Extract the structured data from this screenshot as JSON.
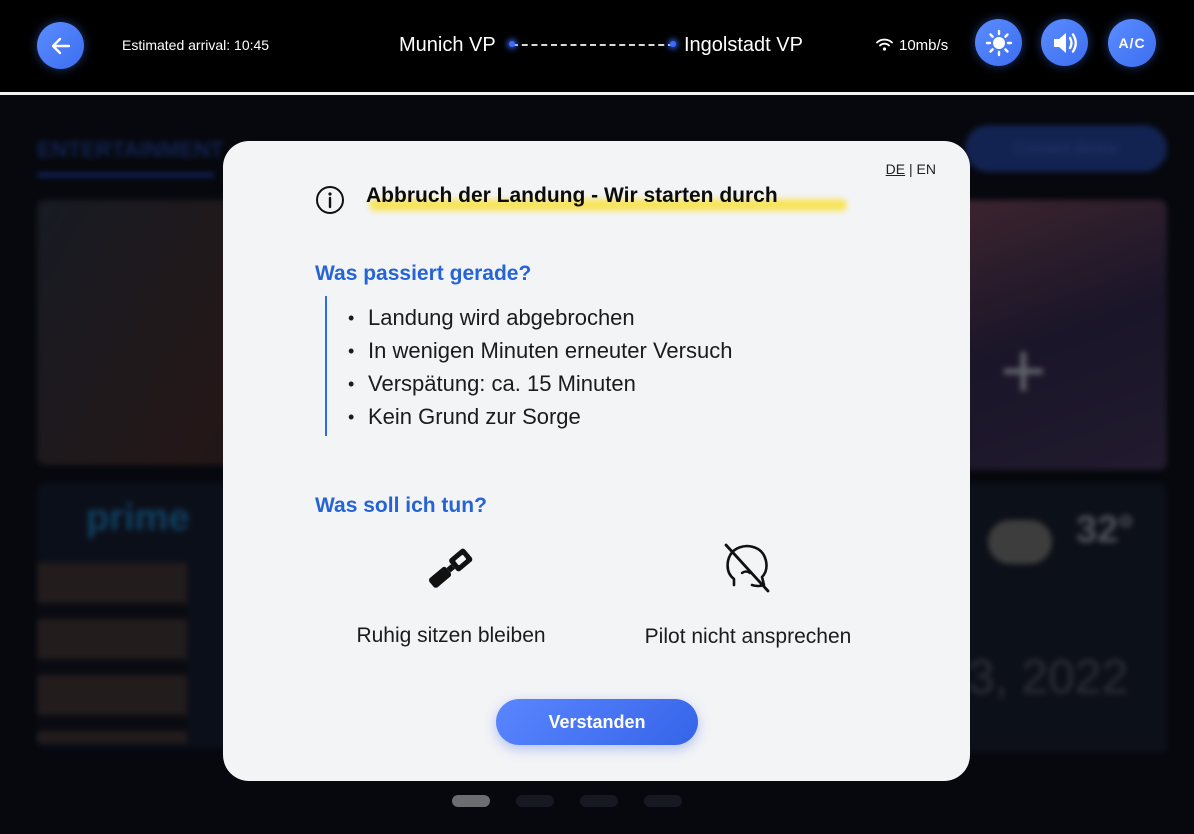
{
  "topbar": {
    "estimated_arrival": "Estimated arrival: 10:45",
    "route_from": "Munich VP",
    "route_to": "Ingolstadt VP",
    "connection_speed": "10mb/s",
    "ac_label": "A/C",
    "icons": [
      "back-arrow-icon",
      "wifi-icon",
      "brightness-icon",
      "volume-icon"
    ]
  },
  "background": {
    "tab_label": "ENTERTAINMENT",
    "connect_label": "Connect device",
    "streaming_logo": "prime",
    "plus_symbol": "+",
    "weather_temp": "32°",
    "date_fragment": "3, 2022"
  },
  "modal": {
    "lang_de": "DE",
    "lang_sep": "|",
    "lang_en": "EN",
    "title": "Abbruch der Landung  - Wir starten durch",
    "section_what_happens": "Was passiert gerade?",
    "bullets": [
      "Landung wird abgebrochen",
      "In wenigen Minuten erneuter Versuch",
      "Verspätung: ca. 15 Minuten",
      "Kein Grund zur Sorge"
    ],
    "bullet_symbol": "•",
    "section_what_to_do": "Was soll ich tun?",
    "action_seat": "Ruhig sitzen bleiben",
    "action_pilot": "Pilot nicht ansprechen",
    "confirm_label": "Verstanden"
  },
  "colors": {
    "accent_blue": "#2563d8",
    "button_blue": "#4a78f5",
    "highlight_yellow": "#f7e45b",
    "modal_bg": "#f3f4f6"
  }
}
